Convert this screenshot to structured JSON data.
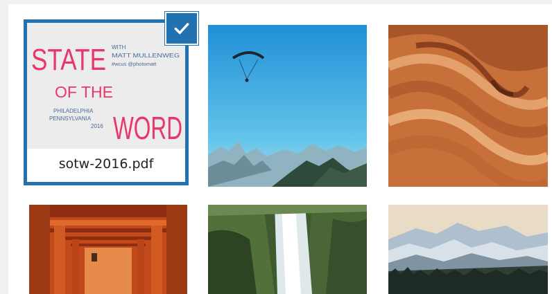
{
  "media_grid": {
    "selected_item": {
      "filename": "sotw-2016.pdf",
      "preview": {
        "title_line1": "STATE",
        "title_line2a": "OF THE",
        "title_line2b": "WORD",
        "with_label": "WITH",
        "speaker": "MATT MULLENWEG",
        "handle": "#wcus @photomatt",
        "city": "PHILADELPHIA",
        "state": "PENNSYLVANIA",
        "year": "2016"
      },
      "check_icon": "checkmark-icon",
      "selected": true
    },
    "items": [
      {
        "kind": "image",
        "subject": "paraglider over mountains"
      },
      {
        "kind": "image",
        "subject": "sandstone wave"
      },
      {
        "kind": "image",
        "subject": "torii gates corridor"
      },
      {
        "kind": "image",
        "subject": "waterfall"
      },
      {
        "kind": "image",
        "subject": "snowy mountain forest"
      }
    ]
  },
  "colors": {
    "selection_blue": "#2271b1",
    "pdf_title_pink": "#e8376b",
    "pdf_text_blue": "#4a6a9a"
  }
}
